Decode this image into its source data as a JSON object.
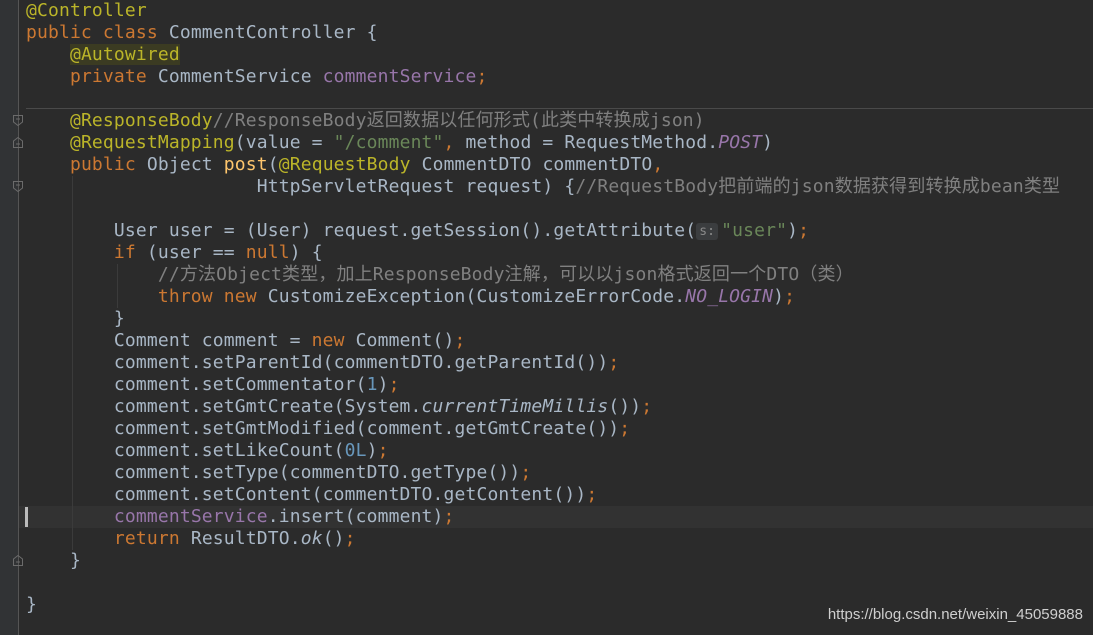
{
  "editor": {
    "theme_colors": {
      "background": "#2b2b2b",
      "keyword": "#cc7832",
      "annotation": "#bbb529",
      "comment": "#808080",
      "string": "#6a8759",
      "field": "#9876aa",
      "number": "#6897bb",
      "method_declaration": "#ffc66d",
      "default_text": "#a9b7c6"
    },
    "lines": [
      {
        "tokens": [
          {
            "t": "ann",
            "v": "@Controller"
          }
        ]
      },
      {
        "tokens": [
          {
            "t": "kw",
            "v": "public class "
          },
          {
            "t": "",
            "v": "CommentController {"
          }
        ]
      },
      {
        "tokens": [
          {
            "t": "",
            "v": "    "
          },
          {
            "t": "ann-hl",
            "v": "@Autowired"
          }
        ]
      },
      {
        "tokens": [
          {
            "t": "",
            "v": "    "
          },
          {
            "t": "kw",
            "v": "private "
          },
          {
            "t": "",
            "v": "CommentService "
          },
          {
            "t": "fld",
            "v": "commentService"
          },
          {
            "t": "kw",
            "v": ";"
          }
        ]
      },
      {
        "tokens": [
          {
            "t": "",
            "v": ""
          }
        ]
      },
      {
        "tokens": [
          {
            "t": "",
            "v": "    "
          },
          {
            "t": "ann",
            "v": "@ResponseBody"
          },
          {
            "t": "cmt",
            "v": "//ResponseBody返回数据以任何形式(此类中转换成json)"
          }
        ]
      },
      {
        "tokens": [
          {
            "t": "",
            "v": "    "
          },
          {
            "t": "ann",
            "v": "@RequestMapping"
          },
          {
            "t": "",
            "v": "(value = "
          },
          {
            "t": "str",
            "v": "\"/comment\""
          },
          {
            "t": "kw",
            "v": ", "
          },
          {
            "t": "",
            "v": "method = RequestMethod."
          },
          {
            "t": "fld-i",
            "v": "POST"
          },
          {
            "t": "",
            "v": ")"
          }
        ]
      },
      {
        "tokens": [
          {
            "t": "",
            "v": "    "
          },
          {
            "t": "kw",
            "v": "public "
          },
          {
            "t": "",
            "v": "Object "
          },
          {
            "t": "fn-decl",
            "v": "post"
          },
          {
            "t": "",
            "v": "("
          },
          {
            "t": "ann",
            "v": "@RequestBody "
          },
          {
            "t": "",
            "v": "CommentDTO commentDTO"
          },
          {
            "t": "kw",
            "v": ","
          }
        ]
      },
      {
        "tokens": [
          {
            "t": "",
            "v": "                     HttpServletRequest request) {"
          },
          {
            "t": "cmt",
            "v": "//RequestBody把前端的json数据获得到转换成bean类型"
          }
        ]
      },
      {
        "tokens": [
          {
            "t": "",
            "v": ""
          }
        ]
      },
      {
        "tokens": [
          {
            "t": "",
            "v": "        User user = (User) request.getSession().getAttribute("
          },
          {
            "t": "hint",
            "v": "s:"
          },
          {
            "t": "str",
            "v": "\"user\""
          },
          {
            "t": "",
            "v": ")"
          },
          {
            "t": "kw",
            "v": ";"
          }
        ]
      },
      {
        "tokens": [
          {
            "t": "",
            "v": "        "
          },
          {
            "t": "kw",
            "v": "if "
          },
          {
            "t": "",
            "v": "(user == "
          },
          {
            "t": "kw",
            "v": "null"
          },
          {
            "t": "",
            "v": ") {"
          }
        ]
      },
      {
        "tokens": [
          {
            "t": "",
            "v": "            "
          },
          {
            "t": "cmt",
            "v": "//方法Object类型，加上ResponseBody注解，可以以json格式返回一个DTO（类）"
          }
        ]
      },
      {
        "tokens": [
          {
            "t": "",
            "v": "            "
          },
          {
            "t": "kw",
            "v": "throw new "
          },
          {
            "t": "",
            "v": "CustomizeException(CustomizeErrorCode."
          },
          {
            "t": "fld-i",
            "v": "NO_LOGIN"
          },
          {
            "t": "",
            "v": ")"
          },
          {
            "t": "kw",
            "v": ";"
          }
        ]
      },
      {
        "tokens": [
          {
            "t": "",
            "v": "        }"
          }
        ]
      },
      {
        "tokens": [
          {
            "t": "",
            "v": "        Comment comment = "
          },
          {
            "t": "kw",
            "v": "new "
          },
          {
            "t": "",
            "v": "Comment()"
          },
          {
            "t": "kw",
            "v": ";"
          }
        ]
      },
      {
        "tokens": [
          {
            "t": "",
            "v": "        comment.setParentId(commentDTO.getParentId())"
          },
          {
            "t": "kw",
            "v": ";"
          }
        ]
      },
      {
        "tokens": [
          {
            "t": "",
            "v": "        comment.setCommentator("
          },
          {
            "t": "num",
            "v": "1"
          },
          {
            "t": "",
            "v": ")"
          },
          {
            "t": "kw",
            "v": ";"
          }
        ]
      },
      {
        "tokens": [
          {
            "t": "",
            "v": "        comment.setGmtCreate(System."
          },
          {
            "t": "ital",
            "v": "currentTimeMillis"
          },
          {
            "t": "",
            "v": "())"
          },
          {
            "t": "kw",
            "v": ";"
          }
        ]
      },
      {
        "tokens": [
          {
            "t": "",
            "v": "        comment.setGmtModified(comment.getGmtCreate())"
          },
          {
            "t": "kw",
            "v": ";"
          }
        ]
      },
      {
        "tokens": [
          {
            "t": "",
            "v": "        comment.setLikeCount("
          },
          {
            "t": "num",
            "v": "0L"
          },
          {
            "t": "",
            "v": ")"
          },
          {
            "t": "kw",
            "v": ";"
          }
        ]
      },
      {
        "tokens": [
          {
            "t": "",
            "v": "        comment.setType(commentDTO.getType())"
          },
          {
            "t": "kw",
            "v": ";"
          }
        ]
      },
      {
        "tokens": [
          {
            "t": "",
            "v": "        comment.setContent(commentDTO.getContent())"
          },
          {
            "t": "kw",
            "v": ";"
          }
        ]
      },
      {
        "tokens": [
          {
            "t": "",
            "v": "        "
          },
          {
            "t": "fld",
            "v": "commentService"
          },
          {
            "t": "",
            "v": ".insert(comment)"
          },
          {
            "t": "kw",
            "v": ";"
          }
        ]
      },
      {
        "tokens": [
          {
            "t": "",
            "v": "        "
          },
          {
            "t": "kw",
            "v": "return "
          },
          {
            "t": "",
            "v": "ResultDTO."
          },
          {
            "t": "ital",
            "v": "ok"
          },
          {
            "t": "",
            "v": "()"
          },
          {
            "t": "kw",
            "v": ";"
          }
        ]
      },
      {
        "tokens": [
          {
            "t": "",
            "v": "    }"
          }
        ]
      },
      {
        "tokens": [
          {
            "t": "",
            "v": ""
          }
        ]
      },
      {
        "tokens": [
          {
            "t": "",
            "v": "}"
          }
        ]
      }
    ],
    "current_line": 24
  },
  "watermark": "https://blog.csdn.net/weixin_45059888"
}
